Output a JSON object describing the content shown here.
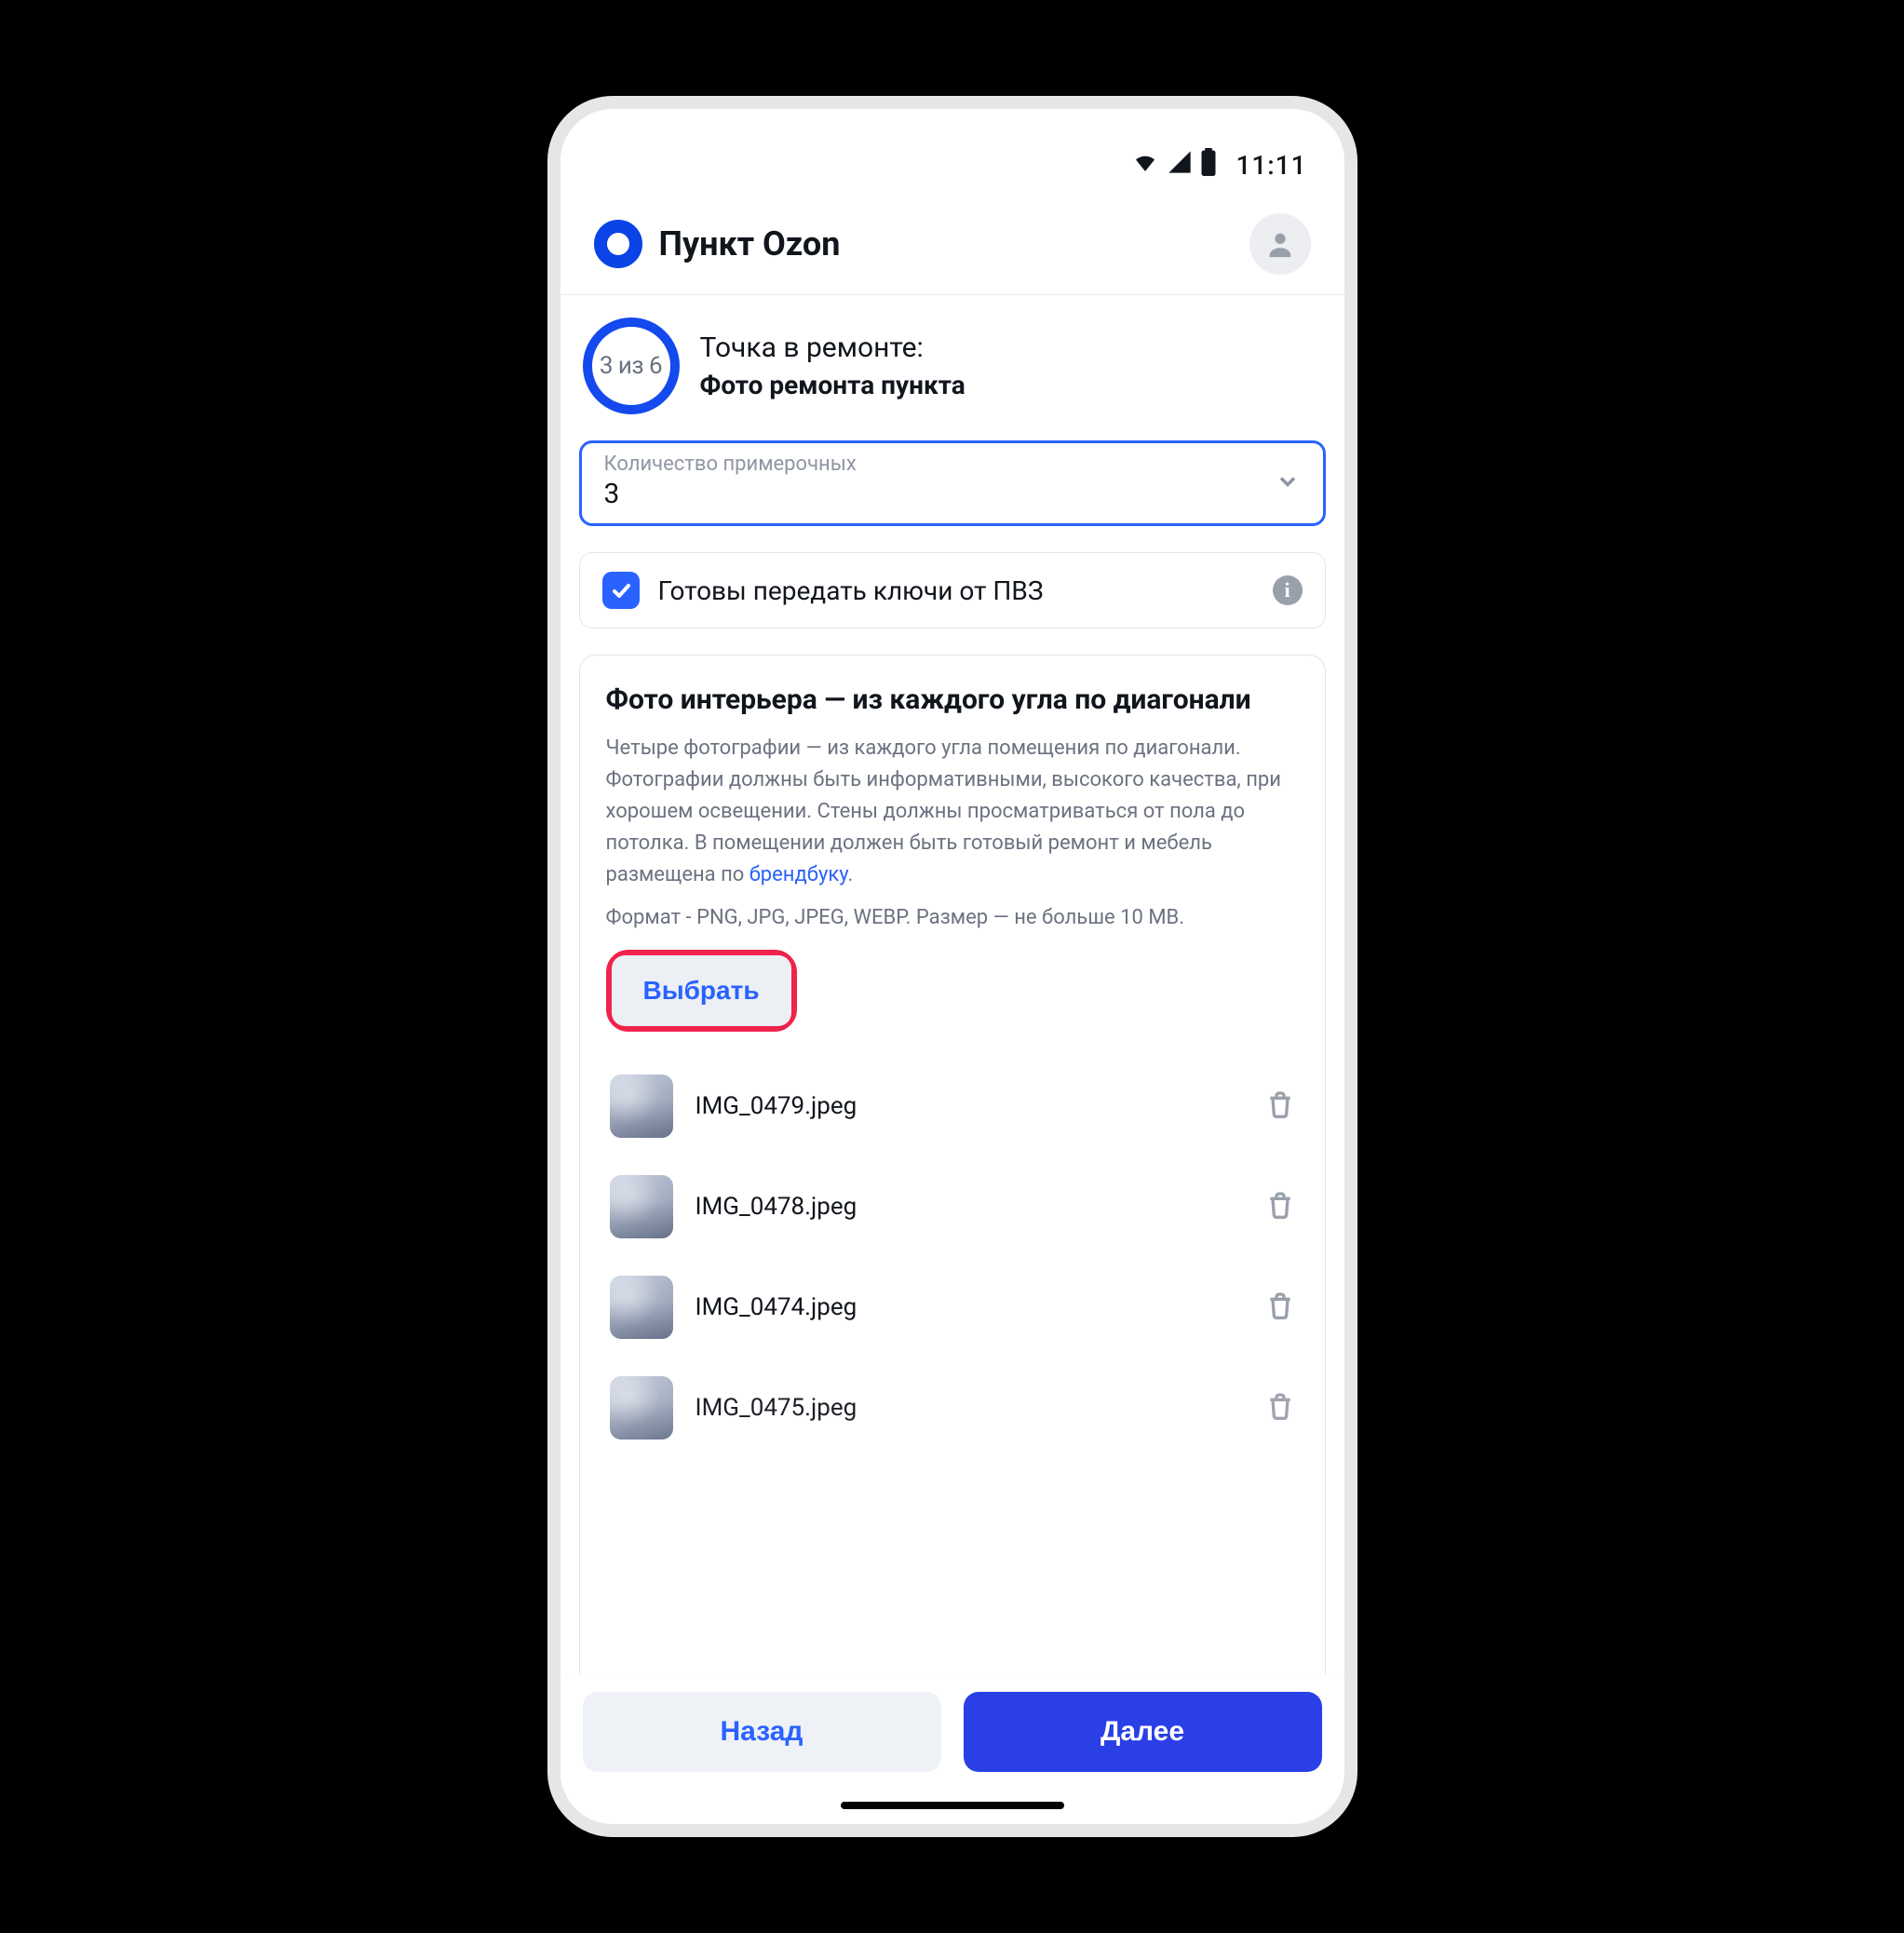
{
  "statusbar": {
    "time": "11:11"
  },
  "header": {
    "app_title": "Пункт Ozon"
  },
  "step": {
    "progress_label": "3 из 6",
    "supertitle": "Точка в ремонте:",
    "subtitle": "Фото ремонта пункта"
  },
  "fitting_rooms": {
    "label": "Количество примерочных",
    "value": "3"
  },
  "keys": {
    "label": "Готовы передать ключи от ПВЗ"
  },
  "upload": {
    "title": "Фото интерьера — из каждого угла по диагонали",
    "description_prefix": "Четыре фотографии — из каждого угла помещения по диагонали. Фотографии должны быть информативными, высокого качества, при хорошем освещении. Стены должны просматриваться от пола до потолка. В помещении должен быть готовый ремонт и мебель размещена по ",
    "description_link": "брендбуку",
    "description_suffix": ".",
    "format_hint": "Формат - PNG, JPG, JPEG, WEBP. Размер — не больше 10 MB.",
    "choose_label": "Выбрать",
    "files": [
      {
        "name": "IMG_0479.jpeg"
      },
      {
        "name": "IMG_0478.jpeg"
      },
      {
        "name": "IMG_0474.jpeg"
      },
      {
        "name": "IMG_0475.jpeg"
      }
    ]
  },
  "footer": {
    "back": "Назад",
    "next": "Далее"
  }
}
